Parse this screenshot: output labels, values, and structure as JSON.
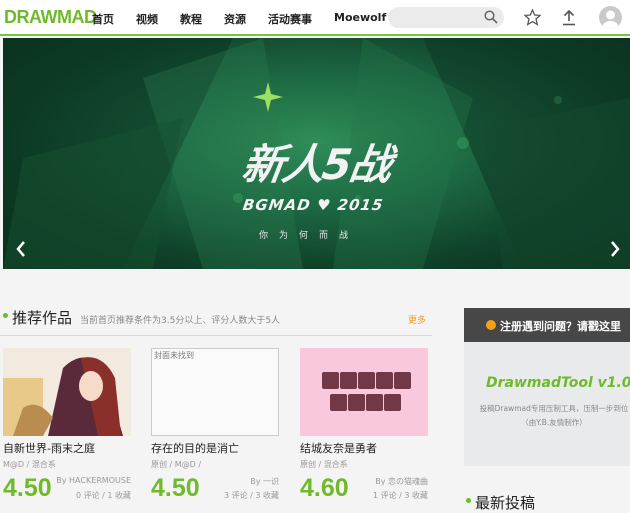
{
  "header": {
    "logo": "DRAWMAD",
    "nav": [
      "首页",
      "视频",
      "教程",
      "资源",
      "活动赛事",
      "Moewolf"
    ],
    "search_placeholder": ""
  },
  "banner": {
    "title": "新人5战",
    "subtitle": "BGMAD ♥ 2015",
    "tagline": "你为何而战"
  },
  "recommended": {
    "title": "推荐作品",
    "description": "当前首页推荐条件为3.5分以上、评分人数大于5人",
    "more": "更多",
    "cards": [
      {
        "title": "自新世界-雨末之庭",
        "meta": "M@D / 混合系",
        "score": "4.50",
        "author": "By HACKERMOUSE",
        "stats": "0 评论 / 1 收藏",
        "thumb_alt": ""
      },
      {
        "title": "存在的目的是消亡",
        "meta": "原创 / M@D /",
        "score": "4.50",
        "author": "By 一识",
        "stats": "3 评论 / 3 收藏",
        "thumb_alt": "封面未找到"
      },
      {
        "title": "结城友奈是勇者",
        "meta": "原创 / 混合系",
        "score": "4.60",
        "author": "By 恋の猫魂曲",
        "stats": "1 评论 / 3 收藏",
        "thumb_alt": ""
      }
    ]
  },
  "sidebar": {
    "notice": "注册遇到问题？请戳这里",
    "tool_title": "DrawmadTool v1.0",
    "tool_desc": "投稿Drawmad专用压制工具，压制一步到位（由Y.B.友情制作）",
    "latest_title": "最新投稿"
  },
  "colors": {
    "accent": "#6fba2c",
    "orange": "#f59c1a"
  }
}
